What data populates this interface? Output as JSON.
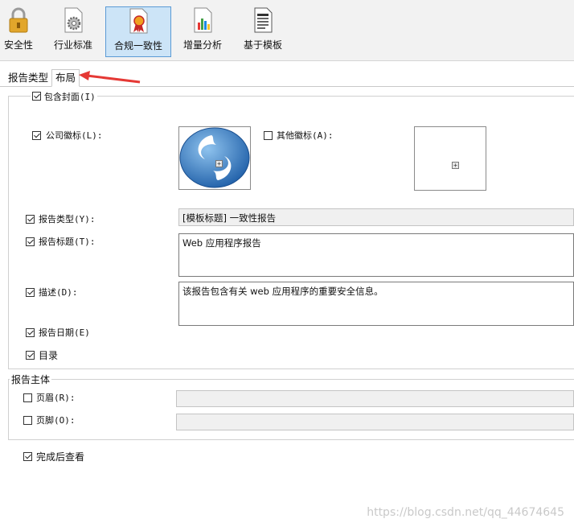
{
  "toolbar": {
    "items": [
      {
        "label": "安全性",
        "icon": "lock-icon"
      },
      {
        "label": "行业标准",
        "icon": "gear-document-icon"
      },
      {
        "label": "合规一致性",
        "icon": "certificate-ribbon-icon",
        "active": true
      },
      {
        "label": "增量分析",
        "icon": "bar-chart-document-icon"
      },
      {
        "label": "基于模板",
        "icon": "template-document-icon"
      }
    ]
  },
  "tabs": [
    "报告类型",
    "布局"
  ],
  "layout": {
    "include_cover": {
      "label": "包含封面(I)",
      "checked": true
    },
    "company_logo": {
      "label": "公司徽标(L):",
      "checked": true,
      "icon": "company-logo-icon"
    },
    "other_logo": {
      "label": "其他徽标(A):",
      "checked": false
    },
    "report_type": {
      "label": "报告类型(Y):",
      "checked": true,
      "value": "[模板标题] 一致性报告"
    },
    "report_title": {
      "label": "报告标题(T):",
      "checked": true,
      "value": "Web 应用程序报告"
    },
    "description": {
      "label": "描述(D):",
      "checked": true,
      "value": "该报告包含有关 web 应用程序的重要安全信息。"
    },
    "report_date": {
      "label": "报告日期(E)",
      "checked": true
    },
    "toc": {
      "label": "目录",
      "checked": true
    }
  },
  "report_body": {
    "title": "报告主体",
    "header": {
      "label": "页眉(R):",
      "checked": false,
      "value": ""
    },
    "footer": {
      "label": "页脚(O):",
      "checked": false,
      "value": ""
    }
  },
  "view_after": {
    "label": "完成后查看",
    "checked": true
  },
  "watermark": "https://blog.csdn.net/qq_44674645",
  "colors": {
    "accent": "#cce4f7",
    "arrow": "#e53935"
  }
}
